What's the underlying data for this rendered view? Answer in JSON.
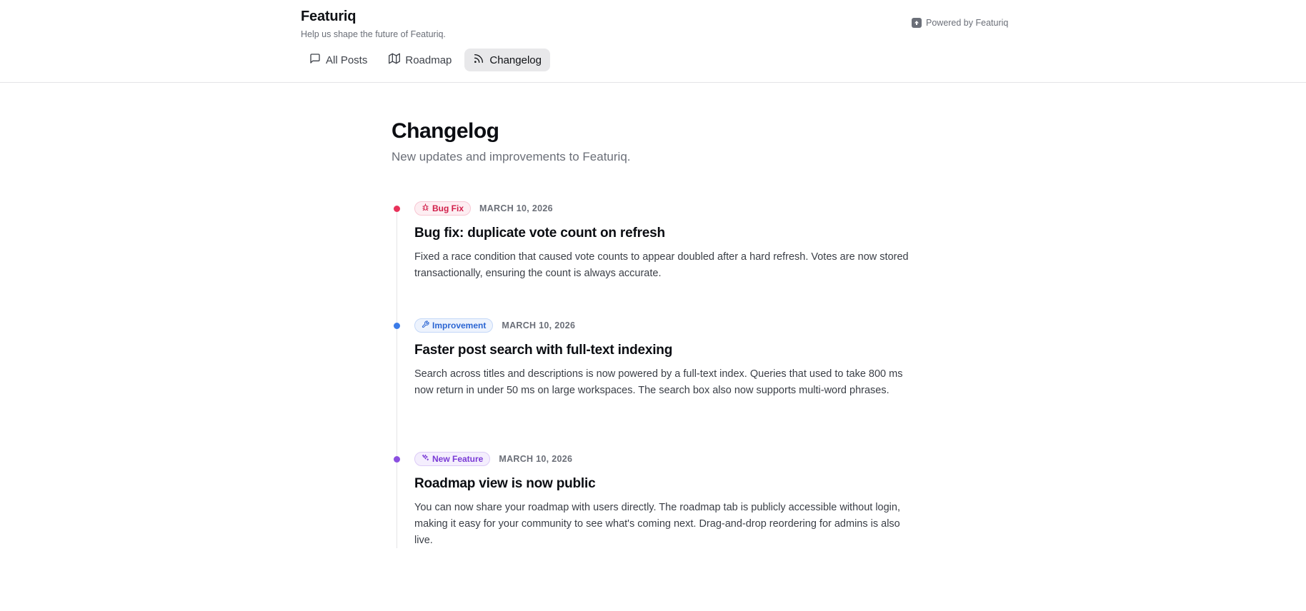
{
  "brand": {
    "name": "Featuriq",
    "tagline": "Help us shape the future of Featuriq.",
    "powered_by": "Powered by Featuriq"
  },
  "nav": {
    "tabs": [
      {
        "label": "All Posts",
        "icon": "message-square-icon",
        "active": false
      },
      {
        "label": "Roadmap",
        "icon": "map-icon",
        "active": false
      },
      {
        "label": "Changelog",
        "icon": "rss-icon",
        "active": true
      }
    ]
  },
  "page": {
    "title": "Changelog",
    "subtitle": "New updates and improvements to Featuriq."
  },
  "entries": [
    {
      "badge": "Bug Fix",
      "badge_icon": "bug-icon",
      "color": "#e8325a",
      "date": "MARCH 10, 2026",
      "title": "Bug fix: duplicate vote count on refresh",
      "body": "Fixed a race condition that caused vote counts to appear doubled after a hard refresh. Votes are now stored transactionally, ensuring the count is always accurate."
    },
    {
      "badge": "Improvement",
      "badge_icon": "wrench-icon",
      "color": "#3b7be8",
      "date": "MARCH 10, 2026",
      "title": "Faster post search with full-text indexing",
      "body": "Search across titles and descriptions is now powered by a full-text index. Queries that used to take 800 ms now return in under 50 ms on large workspaces. The search box also now supports multi-word phrases."
    },
    {
      "badge": "New Feature",
      "badge_icon": "sparkles-icon",
      "color": "#8a4fe0",
      "date": "MARCH 10, 2026",
      "title": "Roadmap view is now public",
      "body": "You can now share your roadmap with users directly. The roadmap tab is publicly accessible without login, making it easy for your community to see what's coming next. Drag-and-drop reordering for admins is also live."
    }
  ]
}
